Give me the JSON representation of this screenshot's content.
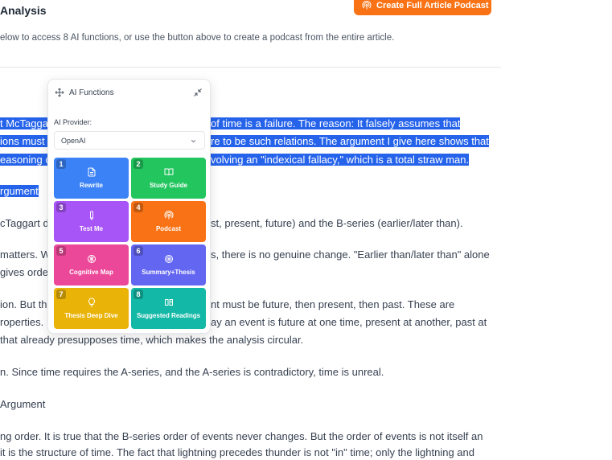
{
  "header": {
    "title": "Analysis",
    "subtitle": "elow to access 8 AI functions, or use the button above to create a podcast from the entire article.",
    "podcast_button": "Create Full Article Podcast"
  },
  "article": {
    "highlight_lines": [
      "t McTagga",
      "ions must f",
      "easoning c"
    ],
    "highlight_lines_right": [
      "of time is a failure. The reason: It falsely assumes that",
      "re to be such relations. The argument I give here shows that",
      "volving an \"indexical fallacy,\" which is a total straw man."
    ],
    "section_heading": "rgument",
    "para1_left": "cTaggart di",
    "para1_right": "st, present, future) and the B-series (earlier/later than).",
    "para2_line1_left": "matters. W",
    "para2_line1_right": "s, there is no genuine change. \"Earlier than/later than\" alone",
    "para2_line2_left": "gives order",
    "para3_line1_left": "ion. But th",
    "para3_line1_right": "nt must be future, then present, then past. These are",
    "para3_line2_left": "roperties.",
    "para3_line2_right": "ay an event is future at one time, present at another, past at",
    "para3_line3": "that already presupposes time, which makes the analysis circular.",
    "para4": "n. Since time requires the A-series, and the A-series is contradictory, time is unreal.",
    "heading2": "Argument",
    "para5_line1": "ng order. It is true that the B-series order of events never changes. But the order of events is not itself an",
    "para5_line2": "it is the structure of time. The fact that lightning precedes thunder is not \"in\" time; only the lightning and"
  },
  "panel": {
    "title": "AI Functions",
    "provider_label": "AI Provider:",
    "provider_value": "OpenAI",
    "tiles": [
      {
        "num": "1",
        "label": "Rewrite",
        "icon": "document-icon",
        "color": "#3b82f6"
      },
      {
        "num": "2",
        "label": "Study Guide",
        "icon": "book-icon",
        "color": "#22c55e"
      },
      {
        "num": "3",
        "label": "Test Me",
        "icon": "pencil-icon",
        "color": "#a855f7"
      },
      {
        "num": "4",
        "label": "Podcast",
        "icon": "podcast-icon",
        "color": "#f97316"
      },
      {
        "num": "5",
        "label": "Cognitive Map",
        "icon": "brain-icon",
        "color": "#ec4899"
      },
      {
        "num": "6",
        "label": "Summary+Thesis",
        "icon": "target-icon",
        "color": "#6366f1"
      },
      {
        "num": "7",
        "label": "Thesis Deep Dive",
        "icon": "lightbulb-icon",
        "color": "#eab308"
      },
      {
        "num": "8",
        "label": "Suggested Readings",
        "icon": "book-open-icon",
        "color": "#14b8a6"
      }
    ]
  },
  "colors": {
    "highlight": "#2563eb",
    "accent": "#f97316"
  }
}
